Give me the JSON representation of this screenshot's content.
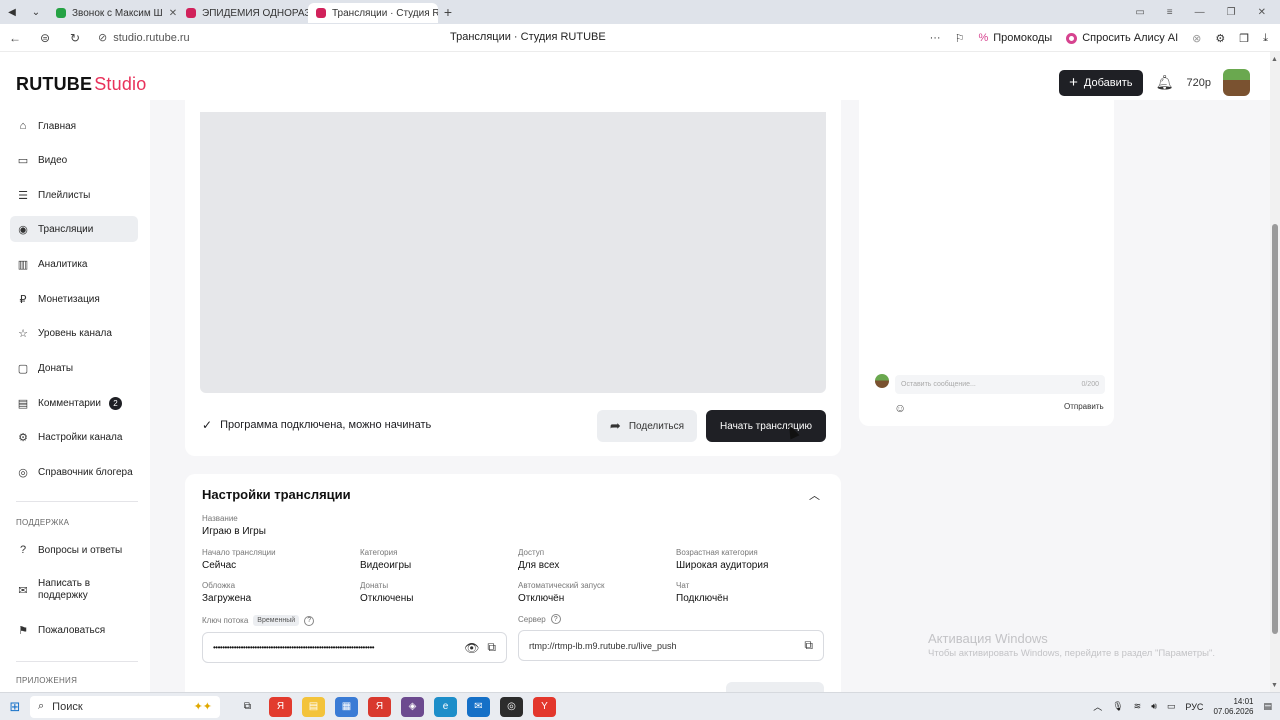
{
  "browser": {
    "tabs": [
      {
        "title": "Звонок с Максим Ш",
        "fav_color": "#25a244",
        "active": false
      },
      {
        "title": "ЭПИДЕМИЯ ОДНОРАЗО",
        "fav_color": "#d1225b",
        "active": false
      },
      {
        "title": "Трансляции · Студия R",
        "fav_color": "#d1225b",
        "active": true
      }
    ],
    "url": "studio.rutube.ru",
    "page_title": "Трансляции · Студия RUTUBE",
    "promo_label": "Промокоды",
    "alice_label": "Спросить Алису AI"
  },
  "header": {
    "logo_main": "RUTUBE",
    "logo_sub": "Studio",
    "add_button": "Добавить",
    "balance": "720р"
  },
  "sidebar": {
    "items": [
      {
        "label": "Главная",
        "icon": "home-icon",
        "glyph": "⌂"
      },
      {
        "label": "Видео",
        "icon": "video-icon",
        "glyph": "▭"
      },
      {
        "label": "Плейлисты",
        "icon": "playlist-icon",
        "glyph": "☰"
      },
      {
        "label": "Трансляции",
        "icon": "broadcast-icon",
        "glyph": "◉"
      },
      {
        "label": "Аналитика",
        "icon": "analytics-icon",
        "glyph": "▥"
      },
      {
        "label": "Монетизация",
        "icon": "ruble-icon",
        "glyph": "₽"
      },
      {
        "label": "Уровень канала",
        "icon": "level-icon",
        "glyph": "☆"
      },
      {
        "label": "Донаты",
        "icon": "donate-icon",
        "glyph": "▢"
      },
      {
        "label": "Комментарии",
        "icon": "comment-icon",
        "glyph": "▤",
        "badge": "2"
      },
      {
        "label": "Настройки канала",
        "icon": "gear-icon",
        "glyph": "⚙"
      },
      {
        "label": "Справочник блогера",
        "icon": "book-icon",
        "glyph": "◎"
      }
    ],
    "support_title": "ПОДДЕРЖКА",
    "support_items": [
      {
        "label": "Вопросы и ответы",
        "icon": "question-icon",
        "glyph": "?"
      },
      {
        "label": "Написать в поддержку",
        "icon": "mail-icon",
        "glyph": "✉"
      },
      {
        "label": "Пожаловаться",
        "icon": "flag-icon",
        "glyph": "⚑"
      }
    ],
    "apps_title": "ПРИЛОЖЕНИЯ"
  },
  "stream": {
    "status": "Программа подключена, можно начинать",
    "share_button": "Поделиться",
    "start_button": "Начать трансляцию"
  },
  "chat": {
    "placeholder": "Оставить сообщение...",
    "counter": "0/200",
    "send": "Отправить"
  },
  "settings": {
    "title": "Настройки трансляции",
    "name_label": "Название",
    "name_value": "Играю в Игры",
    "fields": [
      {
        "label": "Начало трансляции",
        "value": "Сейчас"
      },
      {
        "label": "Категория",
        "value": "Видеоигры"
      },
      {
        "label": "Доступ",
        "value": "Для всех"
      },
      {
        "label": "Возрастная категория",
        "value": "Широкая аудитория"
      },
      {
        "label": "Обложка",
        "value": "Загружена"
      },
      {
        "label": "Донаты",
        "value": "Отключены"
      },
      {
        "label": "Автоматический запуск",
        "value": "Отключён"
      },
      {
        "label": "Чат",
        "value": "Подключён"
      }
    ],
    "key_label": "Ключ потока",
    "key_tag": "Временный",
    "key_value": "••••••••••••••••••••••••••••••••••••••••••••••••••••••••••••••••••••••",
    "server_label": "Сервер",
    "server_value": "rtmp://rtmp-lb.m9.rutube.ru/live_push"
  },
  "watermark": {
    "line1": "Активация Windows",
    "line2": "Чтобы активировать Windows, перейдите в раздел \"Параметры\"."
  },
  "taskbar": {
    "search": "Поиск",
    "lang": "РУС",
    "time": "14:01",
    "date": "07.06.2026"
  }
}
